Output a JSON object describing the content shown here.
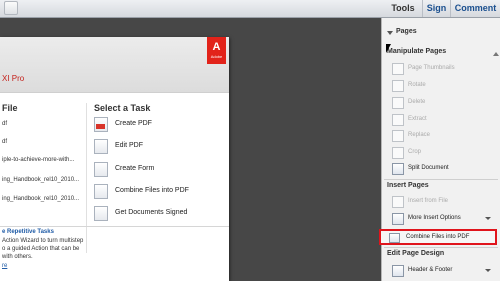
{
  "toolbar": {
    "tabs": [
      "Tools",
      "Sign",
      "Comment"
    ]
  },
  "welcome": {
    "product": "XI Pro",
    "adobe_logo": "Adobe",
    "recent_title": "File",
    "recent_files": [
      "df",
      "df",
      "iple-to-achieve-more-with...",
      "ing_Handbook_rel10_2010...",
      "ing_Handbook_rel10_2010..."
    ],
    "task_title": "Select a Task",
    "tasks": [
      "Create PDF",
      "Edit PDF",
      "Create Form",
      "Combine Files into PDF",
      "Get Documents Signed"
    ],
    "repetitive": {
      "title": "e Repetitive Tasks",
      "lines": [
        "Action Wizard to turn multistep",
        "o a guided Action that can be",
        "with others."
      ],
      "link": "re"
    }
  },
  "panel": {
    "pages_label": "Pages",
    "manipulate_title": "Manipulate Pages",
    "manipulate_items": [
      "Page Thumbnails",
      "Rotate",
      "Delete",
      "Extract",
      "Replace",
      "Crop",
      "Split Document"
    ],
    "insert_title": "Insert Pages",
    "insert_items": [
      "Insert from File",
      "More Insert Options",
      "Combine Files into PDF"
    ],
    "edit_title": "Edit Page Design",
    "edit_items": [
      "Header & Footer"
    ]
  },
  "colors": {
    "highlight": "#e0141c",
    "adobe_red": "#e2231a",
    "link_blue": "#1f5ba6"
  }
}
